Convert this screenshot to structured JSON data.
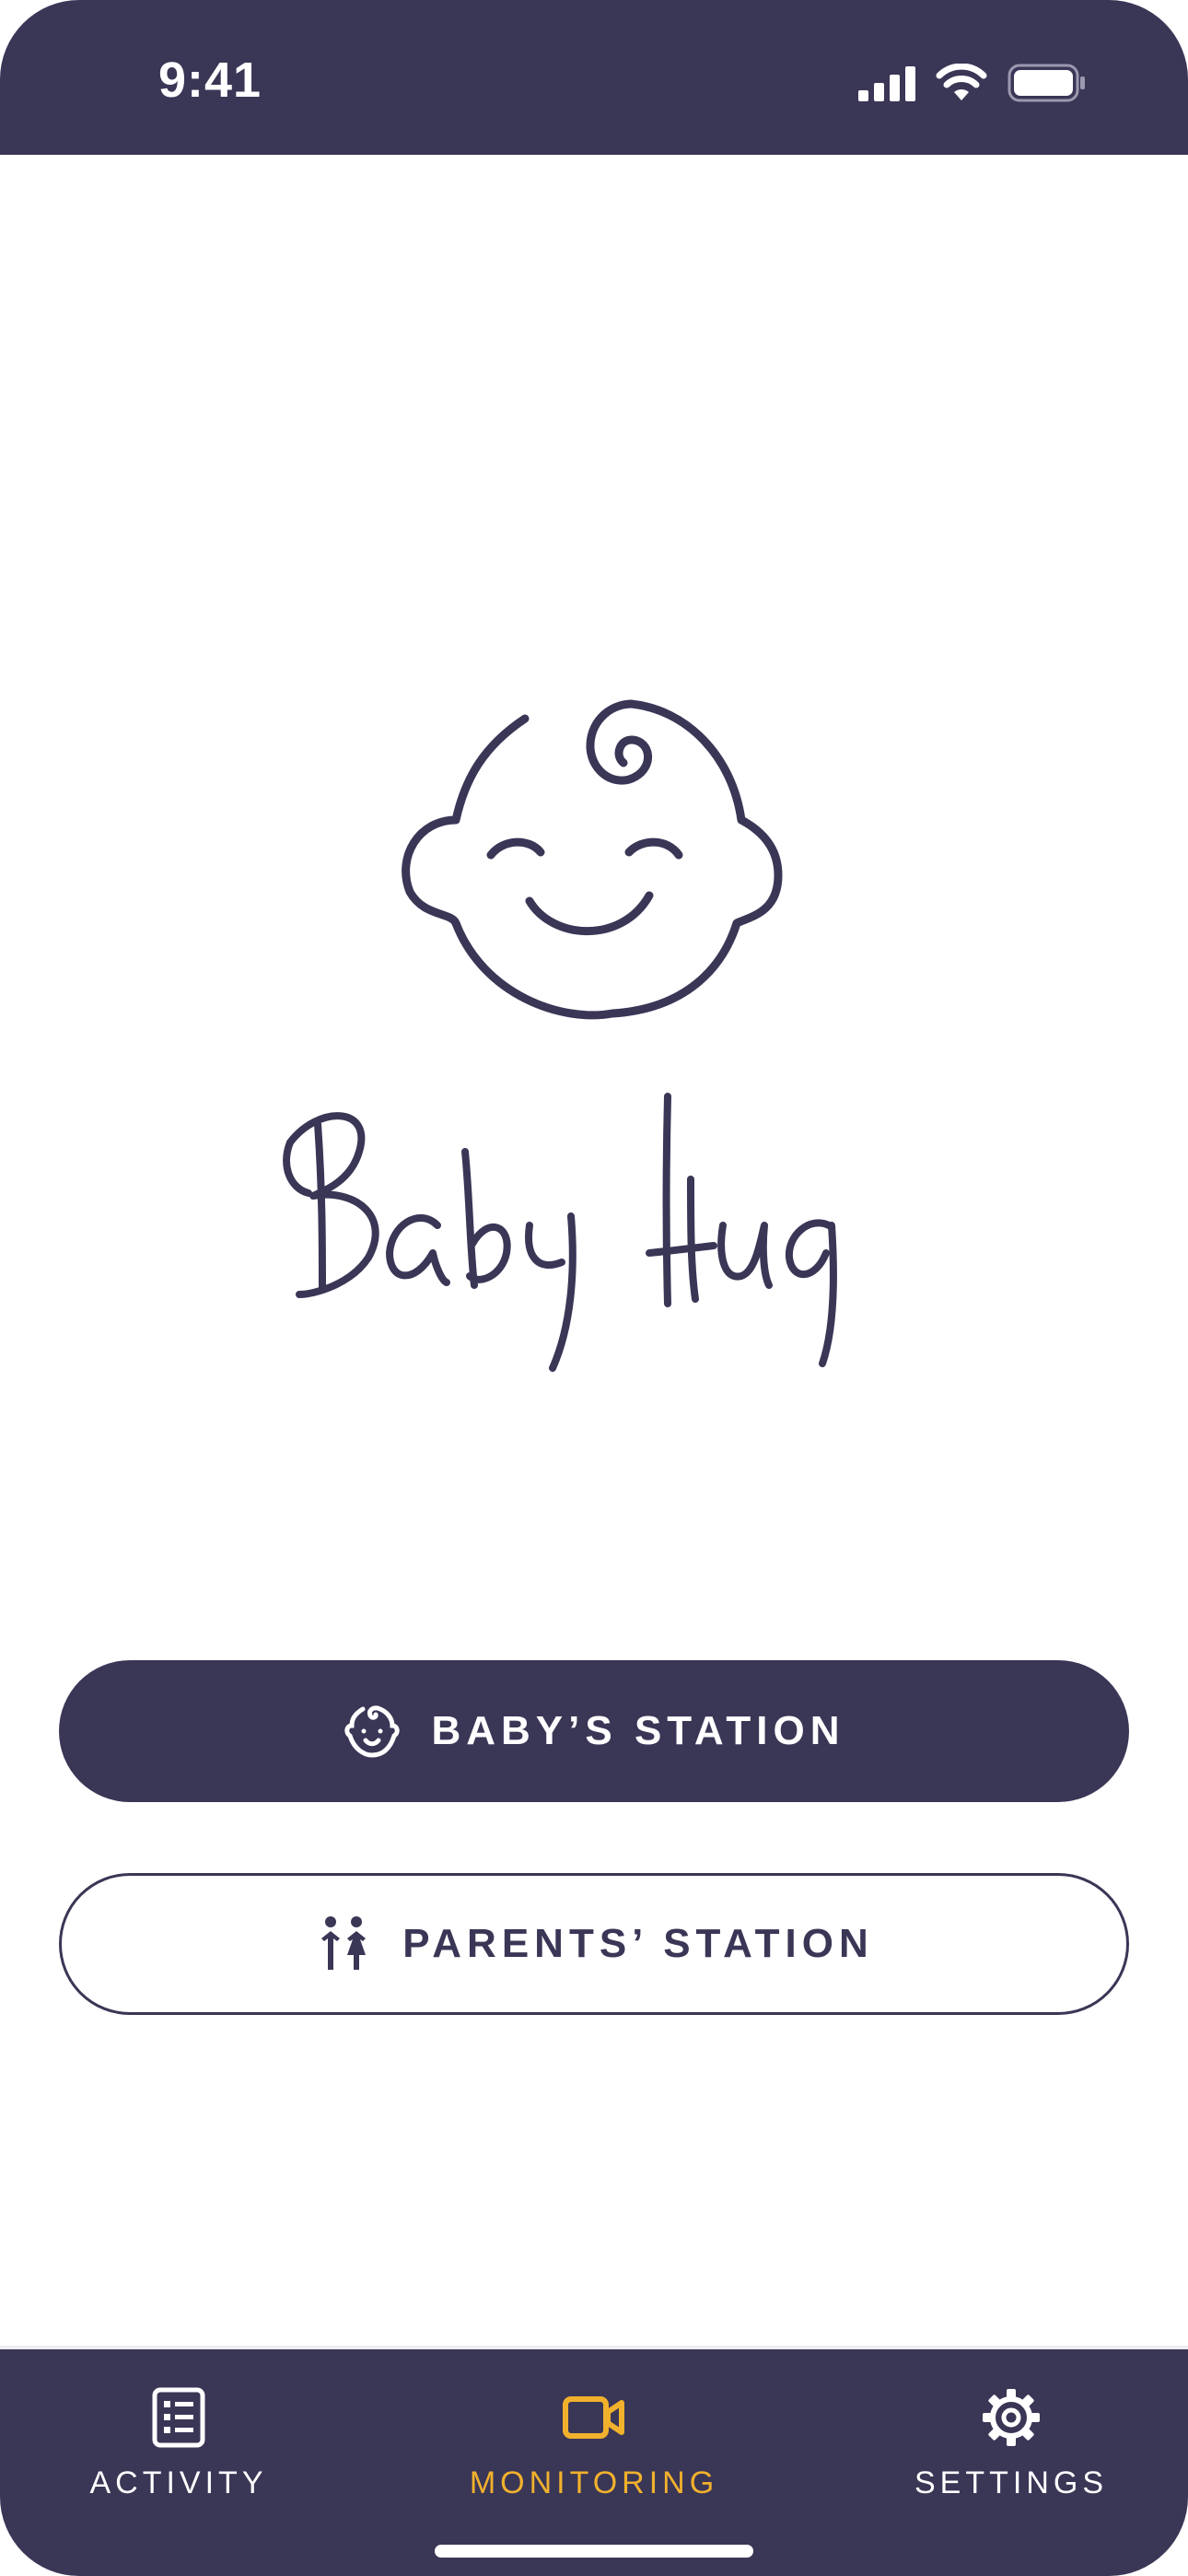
{
  "status_bar": {
    "time": "9:41",
    "icons": [
      "cellular-signal-icon",
      "wifi-icon",
      "battery-icon"
    ]
  },
  "logo": {
    "icon": "baby-face-icon",
    "wordmark": "Baby Hug"
  },
  "buttons": {
    "baby_station": {
      "label": "BABY’S STATION",
      "icon": "baby-face-icon"
    },
    "parents_station": {
      "label": "PARENTS’ STATION",
      "icon": "parents-icon"
    }
  },
  "tab_bar": {
    "tabs": [
      {
        "label": "ACTIVITY",
        "icon": "activity-list-icon",
        "active": false
      },
      {
        "label": "MONITORING",
        "icon": "video-camera-icon",
        "active": true
      },
      {
        "label": "SETTINGS",
        "icon": "gear-icon",
        "active": false
      }
    ]
  },
  "colors": {
    "primary": "#3a3656",
    "accent": "#f1b12d",
    "background": "#ffffff"
  }
}
